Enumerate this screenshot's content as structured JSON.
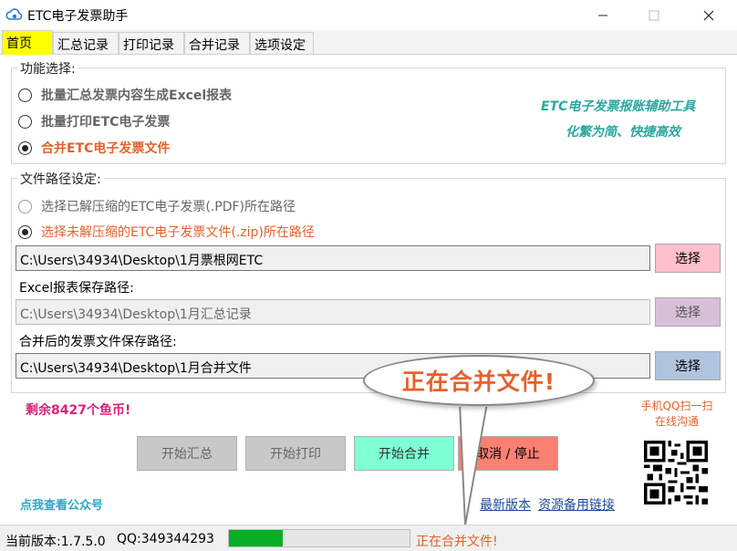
{
  "window": {
    "title": "ETC电子发票助手"
  },
  "tabs": [
    {
      "label": "首页",
      "active": true
    },
    {
      "label": "汇总记录",
      "active": false
    },
    {
      "label": "打印记录",
      "active": false
    },
    {
      "label": "合并记录",
      "active": false
    },
    {
      "label": "选项设定",
      "active": false
    }
  ],
  "function_group": {
    "title": "功能选择:",
    "options": [
      {
        "label": "批量汇总发票内容生成Excel报表",
        "checked": false
      },
      {
        "label": "批量打印ETC电子发票",
        "checked": false
      },
      {
        "label": "合并ETC电子发票文件",
        "checked": true
      }
    ],
    "slogan_line1": "ETC电子发票报账辅助工具",
    "slogan_line2": "化繁为简、快捷高效"
  },
  "path_group": {
    "title": "文件路径设定:",
    "options": [
      {
        "label": "选择已解压缩的ETC电子发票(.PDF)所在路径",
        "checked": false
      },
      {
        "label": "选择未解压缩的ETC电子发票文件(.zip)所在路径",
        "checked": true
      }
    ],
    "source_path": "C:\\Users\\34934\\Desktop\\1月票根网ETC",
    "excel_label": "Excel报表保存路径:",
    "excel_path": "C:\\Users\\34934\\Desktop\\1月汇总记录",
    "merge_label": "合并后的发票文件保存路径:",
    "merge_path": "C:\\Users\\34934\\Desktop\\1月合并文件",
    "choose_label": "选择",
    "choose_colors": [
      "#ffc0cb",
      "#d8bfd8",
      "#b0c4de"
    ]
  },
  "coins_text": "剩余8427个鱼币!",
  "qq_note_line1": "手机QQ扫一扫",
  "qq_note_line2": "在线沟通",
  "actions": {
    "summary": "开始汇总",
    "print": "开始打印",
    "merge": "开始合并",
    "cancel": "取消 / 停止"
  },
  "links": {
    "public": "点我查看公众号",
    "latest": "最新版本",
    "backup": "资源备用链接"
  },
  "bubble_text": "正在合并文件!",
  "status": {
    "version": "当前版本:1.7.5.0",
    "qq": "QQ:349344293",
    "progress": 0.3,
    "text": "正在合并文件!"
  },
  "colors": {
    "accent_orange": "#e4612c",
    "slogan": "#2aa8a0",
    "coins": "#d8237a",
    "merge_button": "#7fffd4",
    "cancel_button": "#fa8072",
    "disabled_button": "#c8c8c8",
    "progress_green": "#06b025"
  }
}
